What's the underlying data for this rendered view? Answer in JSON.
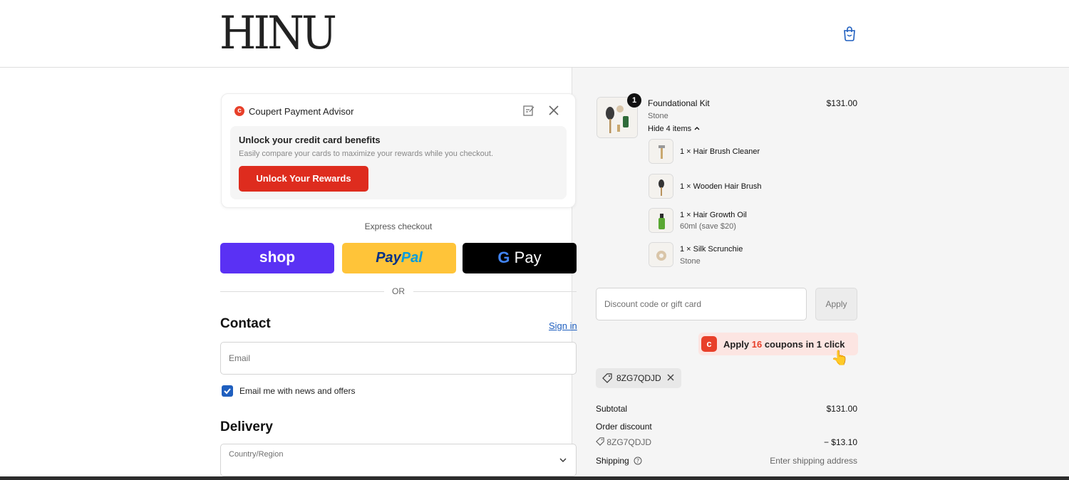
{
  "header": {
    "logo": "HINU"
  },
  "coupert": {
    "title": "Coupert Payment Advisor",
    "heading": "Unlock your credit card benefits",
    "subtext": "Easily compare your cards to maximize your rewards while you checkout.",
    "button": "Unlock Your Rewards"
  },
  "express": {
    "label": "Express checkout",
    "shop": "shop",
    "paypal_a": "Pay",
    "paypal_b": "Pal",
    "gpay_g": "G",
    "gpay_pay": "Pay",
    "or": "OR"
  },
  "contact": {
    "heading": "Contact",
    "signin": "Sign in",
    "email_placeholder": "Email",
    "newsletter": "Email me with news and offers",
    "newsletter_checked": true
  },
  "delivery": {
    "heading": "Delivery",
    "country_label": "Country/Region"
  },
  "order": {
    "product": {
      "title": "Foundational Kit",
      "variant": "Stone",
      "quantity": "1",
      "price": "$131.00",
      "toggle": "Hide 4 items"
    },
    "items": [
      {
        "name": "1 × Hair Brush Cleaner",
        "variant": ""
      },
      {
        "name": "1 × Wooden Hair Brush",
        "variant": ""
      },
      {
        "name": "1 × Hair Growth Oil",
        "variant": "60ml (save $20)"
      },
      {
        "name": "1 × Silk Scrunchie",
        "variant": "Stone"
      }
    ],
    "discount_placeholder": "Discount code or gift card",
    "apply": "Apply",
    "coupons_a": "Apply ",
    "coupons_count": "16",
    "coupons_b": " coupons in 1 click",
    "code": "8ZG7QDJD",
    "subtotal_label": "Subtotal",
    "subtotal": "$131.00",
    "order_discount_label": "Order discount",
    "discount_code": "8ZG7QDJD",
    "discount_value": "− $13.10",
    "shipping_label": "Shipping",
    "shipping_value": "Enter shipping address"
  }
}
